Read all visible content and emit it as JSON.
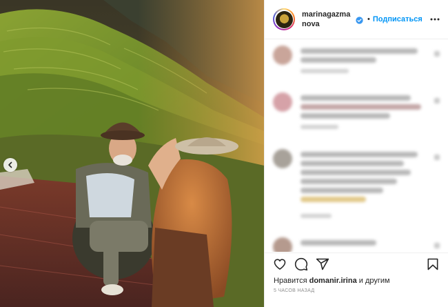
{
  "post": {
    "username": "marinagazmanova",
    "separator": "•",
    "follow_label": "Подписаться",
    "likes_prefix": "Нравится",
    "likes_user": "domanir.irina",
    "likes_suffix": "и другим",
    "timestamp": "5 часов назад"
  },
  "icons": {
    "verified": "verified-badge-icon",
    "more": "more-options-icon",
    "prev": "chevron-left-icon",
    "like": "heart-icon",
    "comment": "comment-icon",
    "share": "share-icon",
    "save": "bookmark-icon"
  },
  "colors": {
    "accent": "#0095f6",
    "text": "#262626",
    "muted": "#8e8e8e"
  }
}
